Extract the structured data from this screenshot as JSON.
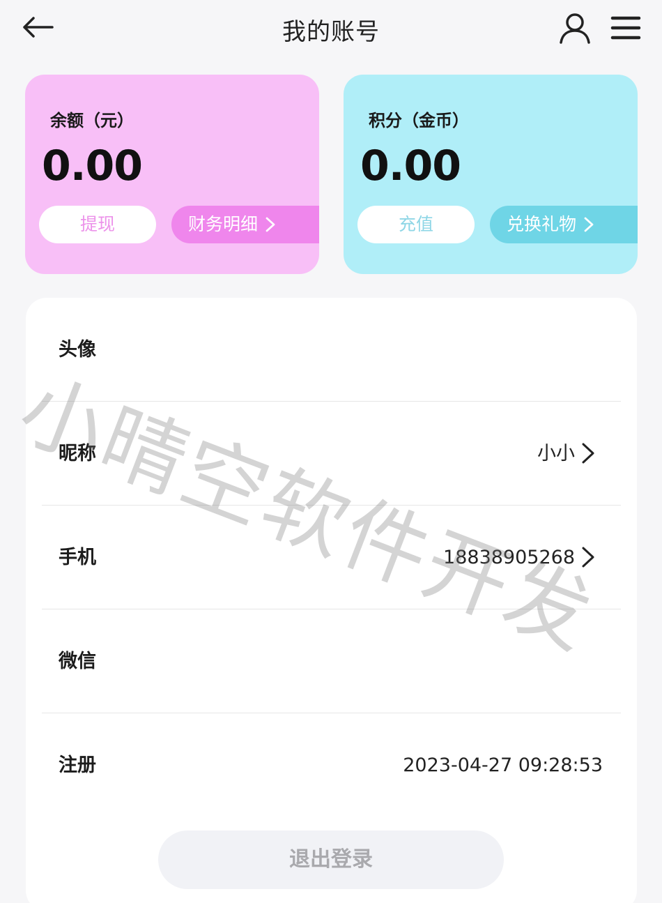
{
  "header": {
    "title": "我的账号",
    "back_icon": "arrow-left-icon",
    "user_icon": "user-icon",
    "menu_icon": "menu-icon"
  },
  "cards": {
    "balance": {
      "label": "余额（元）",
      "value": "0.00",
      "primary_button": "提现",
      "secondary_button": "财务明细",
      "color": "#f8bff7",
      "accent": "#ef86ec"
    },
    "points": {
      "label": "积分（金币）",
      "value": "0.00",
      "primary_button": "充值",
      "secondary_button": "兑换礼物",
      "color": "#b0eef8",
      "accent": "#6fd5e6"
    }
  },
  "profile": {
    "rows": [
      {
        "label": "头像",
        "value": ""
      },
      {
        "label": "昵称",
        "value": "小小"
      },
      {
        "label": "手机",
        "value": "18838905268"
      },
      {
        "label": "微信",
        "value": ""
      },
      {
        "label": "注册",
        "value": "2023-04-27 09:28:53"
      }
    ]
  },
  "logout_button": "退出登录",
  "watermark": "小晴空软件开发"
}
